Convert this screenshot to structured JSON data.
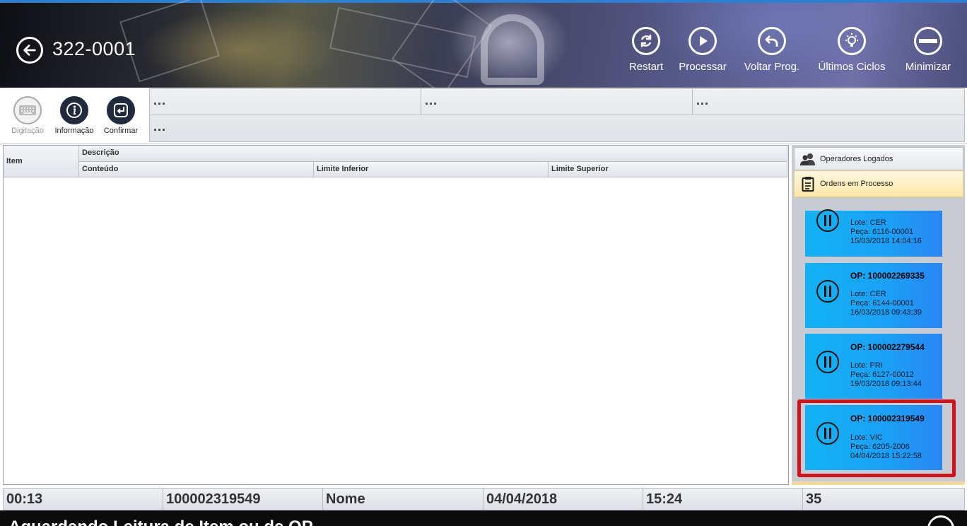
{
  "header": {
    "machine_id": "322-0001",
    "actions": [
      {
        "label": "Restart",
        "icon": "restart-icon"
      },
      {
        "label": "Processar",
        "icon": "play-icon"
      },
      {
        "label": "Voltar Prog.",
        "icon": "undo-icon"
      },
      {
        "label": "Últimos Ciclos",
        "icon": "lightbulb-icon"
      },
      {
        "label": "Minimizar",
        "icon": "minus-icon"
      }
    ]
  },
  "toolbar": {
    "buttons": [
      {
        "label": "Digitação",
        "icon": "keyboard-icon",
        "enabled": false
      },
      {
        "label": "Informação",
        "icon": "info-icon",
        "enabled": true
      },
      {
        "label": "Confirmar",
        "icon": "enter-icon",
        "enabled": true
      }
    ],
    "info_cells": [
      "...",
      "...",
      "...",
      "..."
    ]
  },
  "grid": {
    "item_header": "Item",
    "descricao_header": "Descrição",
    "columns": [
      "Conteúdo",
      "Limite Inferior",
      "Limite Superior"
    ],
    "rows": []
  },
  "side_panel": {
    "tabs": [
      {
        "label": "Operadores Logados",
        "icon": "users-icon",
        "active": false
      },
      {
        "label": "Ordens em Processo",
        "icon": "clipboard-icon",
        "active": true
      }
    ],
    "orders": [
      {
        "op": "",
        "lote": "Lote: CER",
        "peca": "Peça: 6116-00001",
        "datetime": "15/03/2018 14:04:16",
        "selected": false
      },
      {
        "op": "OP: 100002269335",
        "lote": "Lote: CER",
        "peca": "Peça: 6144-00001",
        "datetime": "16/03/2018 09:43:39",
        "selected": false
      },
      {
        "op": "OP: 100002279544",
        "lote": "Lote: PRI",
        "peca": "Peça: 6127-00012",
        "datetime": "19/03/2018 09:13:44",
        "selected": false
      },
      {
        "op": "OP: 100002319549",
        "lote": "Lote: VIC",
        "peca": "Peça: 6205-2006",
        "datetime": "04/04/2018 15:22:58",
        "selected": true
      }
    ]
  },
  "status_bar": {
    "cells": [
      "00:13",
      "100002319549",
      "Nome",
      "04/04/2018",
      "15:24",
      "35"
    ]
  },
  "bottom": {
    "text": "Aguardando Leitura de Item ou de OP"
  },
  "colors": {
    "accent_blue": "#1aa0f6",
    "highlight_red": "#d0121d",
    "tab_active": "#fde7a6"
  }
}
